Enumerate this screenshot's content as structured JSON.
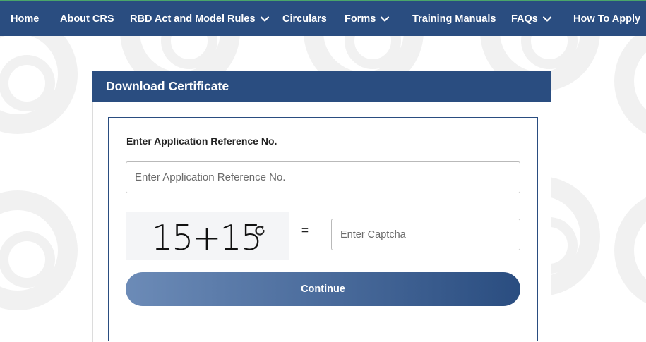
{
  "nav": {
    "items": [
      {
        "label": "Home",
        "dropdown": false
      },
      {
        "label": "About CRS",
        "dropdown": false
      },
      {
        "label": "RBD Act and Model Rules",
        "dropdown": true
      },
      {
        "label": "Circulars",
        "dropdown": false
      },
      {
        "label": "Forms",
        "dropdown": true
      },
      {
        "label": "Training Manuals",
        "dropdown": false
      },
      {
        "label": "FAQs",
        "dropdown": true
      },
      {
        "label": "How To Apply",
        "dropdown": false
      }
    ]
  },
  "card": {
    "title": "Download Certificate",
    "field_label": "Enter Application Reference No.",
    "ref_placeholder": "Enter Application Reference No.",
    "ref_value": "",
    "captcha": {
      "expression": "15+15",
      "equals": "=",
      "placeholder": "Enter Captcha",
      "value": ""
    },
    "continue_label": "Continue"
  },
  "colors": {
    "primary": "#2a4d80",
    "accent_line": "#4aa56a",
    "button_gradient_start": "#6c8bb7"
  },
  "icons": {
    "dropdown": "chevron-down-icon",
    "captcha_refresh": "refresh-icon"
  }
}
